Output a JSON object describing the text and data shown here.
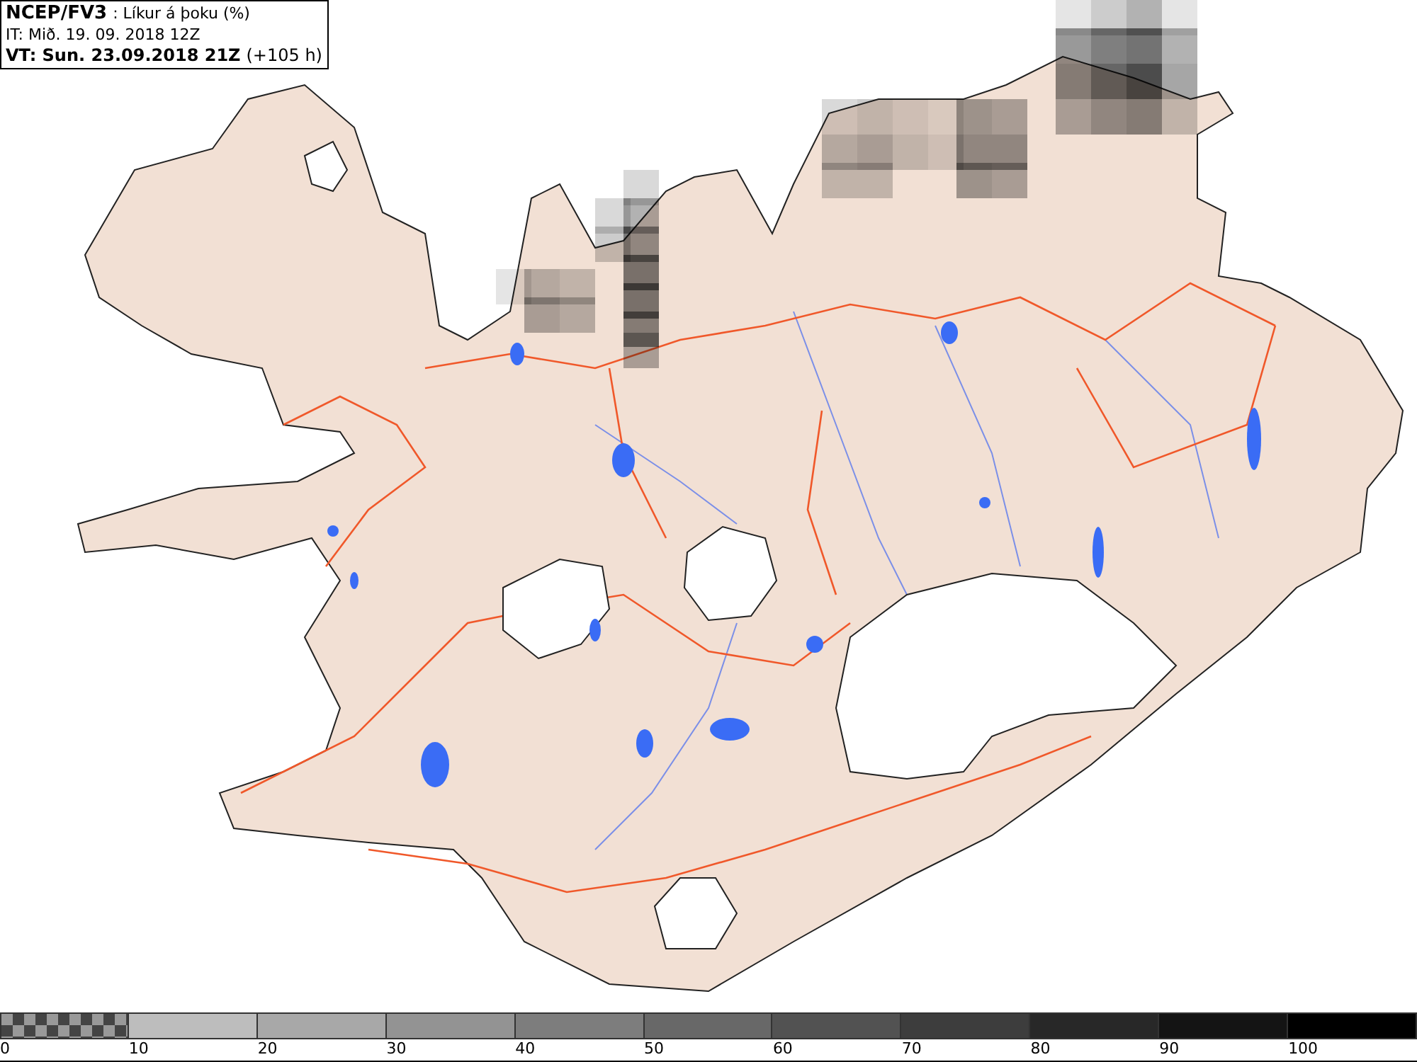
{
  "title": {
    "model": "NCEP/FV3",
    "product": ": Líkur á þoku (%)",
    "issued": "IT: Mið. 19. 09. 2018 12Z",
    "valid": "VT: Sun. 23.09.2018 21Z",
    "offset": "(+105 h)"
  },
  "legend": [
    {
      "label": "0",
      "kind": "checker"
    },
    {
      "label": "10",
      "kind": "solid",
      "color": "#bdbdbd"
    },
    {
      "label": "20",
      "kind": "solid",
      "color": "#a8a8a8"
    },
    {
      "label": "30",
      "kind": "solid",
      "color": "#939393"
    },
    {
      "label": "40",
      "kind": "solid",
      "color": "#7d7d7d"
    },
    {
      "label": "50",
      "kind": "solid",
      "color": "#686868"
    },
    {
      "label": "60",
      "kind": "solid",
      "color": "#525252"
    },
    {
      "label": "70",
      "kind": "solid",
      "color": "#3d3d3d"
    },
    {
      "label": "80",
      "kind": "solid",
      "color": "#282828"
    },
    {
      "label": "90",
      "kind": "solid",
      "color": "#141414"
    },
    {
      "label": "100",
      "kind": "solid",
      "color": "#000000"
    }
  ]
}
